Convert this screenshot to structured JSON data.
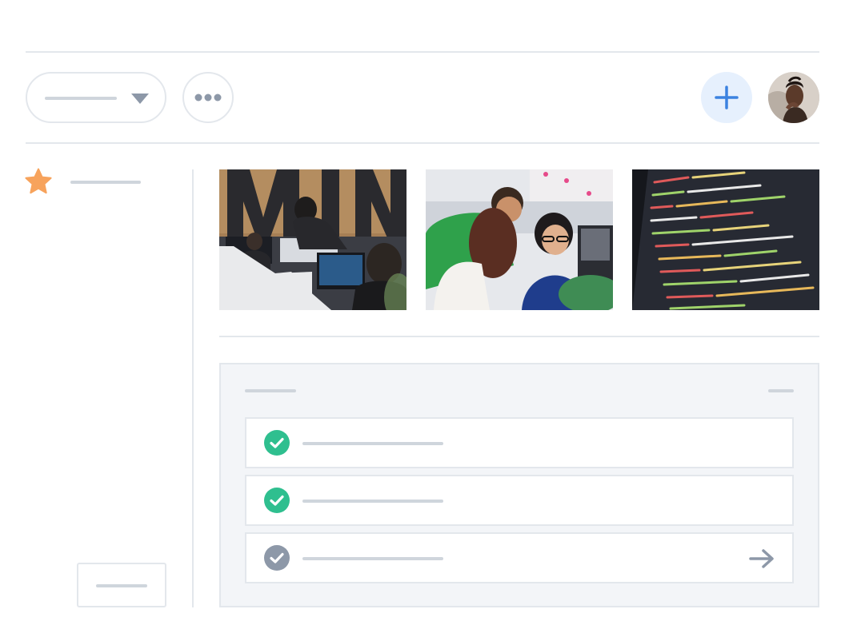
{
  "header": {
    "filter_dropdown": {
      "value": ""
    },
    "more_button": {
      "icon": "more-horizontal-icon"
    },
    "add_button": {
      "icon": "plus-icon",
      "color": "#3b82e0"
    },
    "avatar": {
      "icon": "user-avatar"
    }
  },
  "sidebar": {
    "favorite": {
      "icon": "star-icon",
      "color": "#f7a35c",
      "label": ""
    },
    "footer_button": {
      "label": ""
    }
  },
  "gallery": {
    "images": [
      {
        "name": "office-workspace-photo"
      },
      {
        "name": "team-collaboration-photo"
      },
      {
        "name": "code-screen-photo"
      }
    ]
  },
  "tasks": {
    "title": "",
    "action": "",
    "items": [
      {
        "label": "",
        "status": "done",
        "color": "#2fbf8f"
      },
      {
        "label": "",
        "status": "done",
        "color": "#2fbf8f"
      },
      {
        "label": "",
        "status": "pending",
        "color": "#8d98a8",
        "icon": "arrow-right-icon"
      }
    ]
  }
}
